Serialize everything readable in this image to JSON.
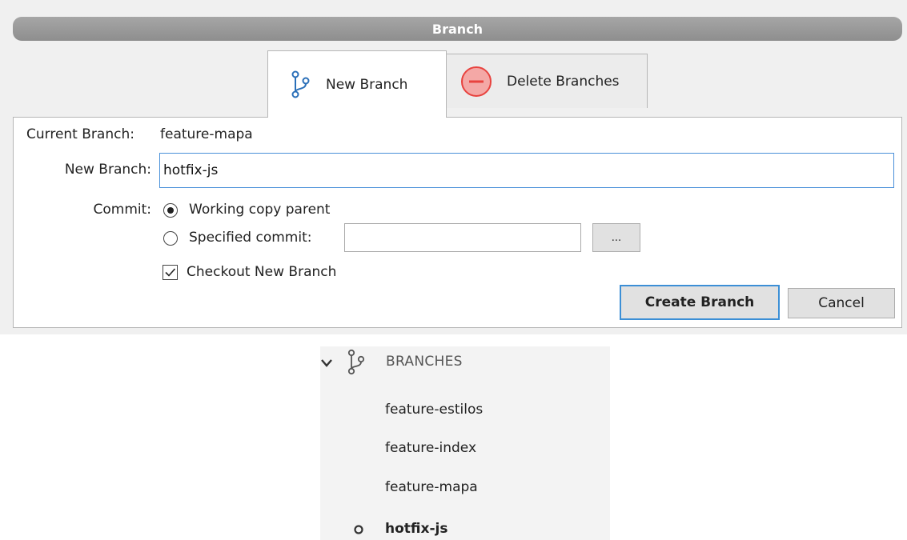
{
  "dialog": {
    "title": "Branch",
    "tabs": [
      {
        "label": "New Branch",
        "icon": "branch-icon",
        "active": true
      },
      {
        "label": "Delete Branches",
        "icon": "minus-circle-icon",
        "active": false
      }
    ],
    "current_branch_label": "Current Branch:",
    "current_branch_value": "feature-mapa",
    "new_branch_label": "New Branch:",
    "new_branch_value": "hotfix-js",
    "commit_label": "Commit:",
    "commit_options": [
      {
        "label": "Working copy parent",
        "checked": true
      },
      {
        "label": "Specified commit:",
        "checked": false
      }
    ],
    "specified_commit_value": "",
    "browse_label": "...",
    "checkout_label": "Checkout New Branch",
    "checkout_checked": true,
    "create_label": "Create Branch",
    "cancel_label": "Cancel"
  },
  "sidebar": {
    "header": "BRANCHES",
    "expanded": true,
    "items": [
      {
        "label": "feature-estilos",
        "current": false
      },
      {
        "label": "feature-index",
        "current": false
      },
      {
        "label": "feature-mapa",
        "current": false
      },
      {
        "label": "hotfix-js",
        "current": true
      }
    ]
  },
  "colors": {
    "accent": "#3c8fd6",
    "title_bar": "#9a9a9a",
    "delete_icon": "#e8433f",
    "branch_icon": "#2a6fb8"
  }
}
